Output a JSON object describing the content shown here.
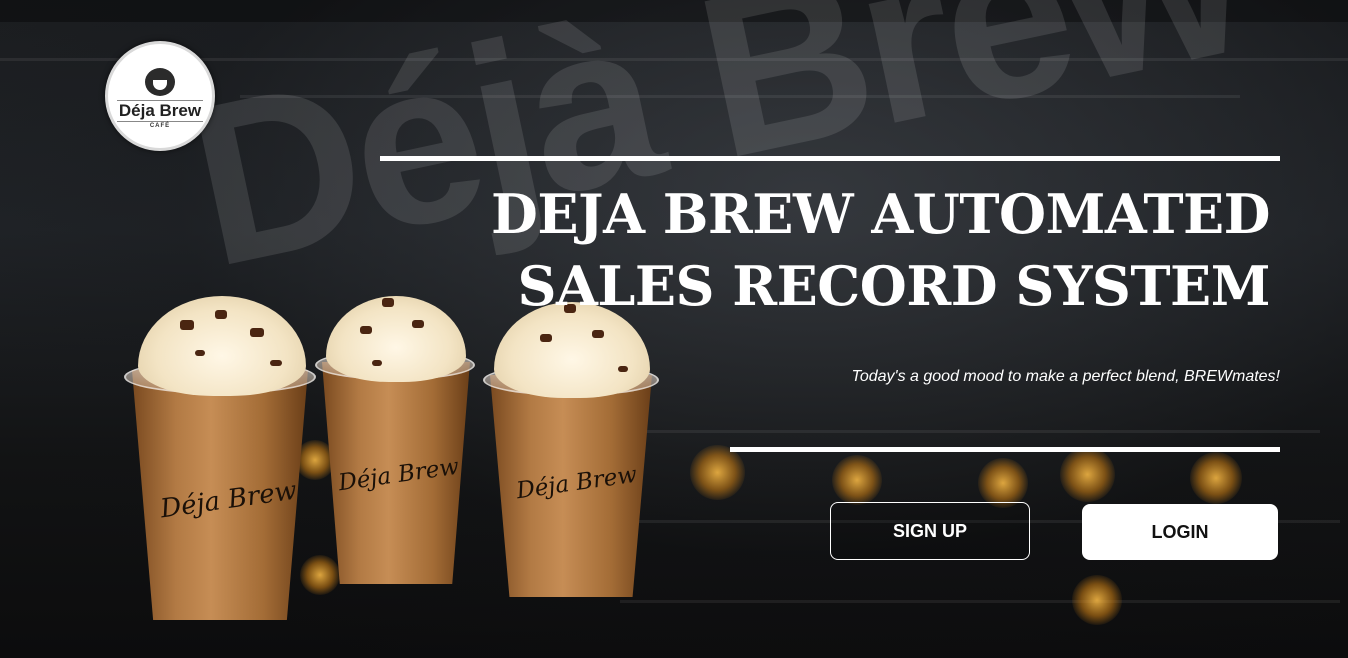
{
  "brand": {
    "logo_name": "Déja Brew",
    "logo_sub": "CAFÉ",
    "background_sign": "Déjà Brew"
  },
  "hero": {
    "title_line1": "DEJA BREW AUTOMATED",
    "title_line2": "SALES RECORD SYSTEM",
    "tagline": "Today's a good mood to make a perfect blend, BREWmates!"
  },
  "actions": {
    "signup_label": "SIGN UP",
    "login_label": "LOGIN"
  },
  "cups": [
    {
      "script": "Déja Brew"
    },
    {
      "script": "Déja Brew"
    },
    {
      "script": "Déja Brew"
    }
  ],
  "colors": {
    "accent": "#ffffff",
    "background": "#0f0f10",
    "login_button_bg": "#ffffff",
    "login_button_text": "#111111"
  }
}
